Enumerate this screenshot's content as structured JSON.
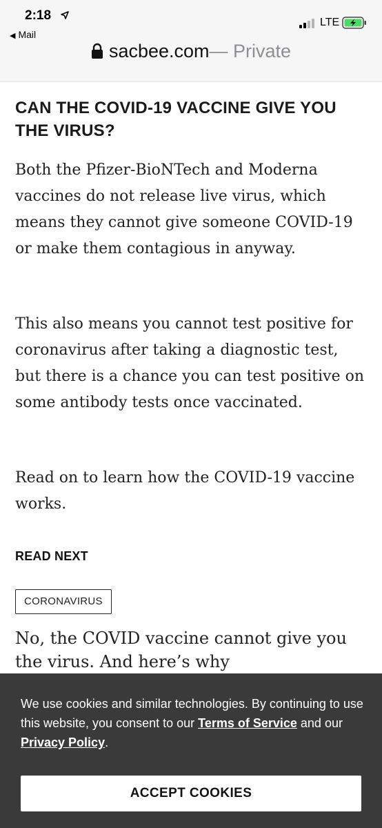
{
  "status_bar": {
    "time": "2:18",
    "back_app": "Mail",
    "network": "LTE"
  },
  "url_bar": {
    "domain": "sacbee.com",
    "mode": "— Private"
  },
  "article": {
    "headline": "CAN THE COVID-19 VACCINE GIVE YOU THE VIRUS?",
    "paragraphs": [
      "Both the Pfizer-BioNTech and Moderna vaccines do not release live virus, which means they cannot give someone COVID-19 or make them contagious in anyway.",
      "This also means you cannot test positive for coronavirus after taking a diagnostic test, but there is a chance you can test positive on some antibody tests once vaccinated.",
      "Read on to learn how the COVID-19 vaccine works."
    ],
    "read_next_label": "READ NEXT",
    "tag": "CORONAVIRUS",
    "related_title": "No, the COVID vaccine cannot give you the virus. And here’s why"
  },
  "cookie_banner": {
    "text_before": "We use cookies and similar technologies. By continuing to use this website, you consent to our ",
    "terms_link": "Terms of Service",
    "text_middle": " and our ",
    "privacy_link": "Privacy Policy",
    "text_after": ".",
    "accept_label": "ACCEPT COOKIES"
  },
  "icons": {
    "location": "location-arrow-icon",
    "lock": "lock-icon",
    "signal": "cellular-signal-icon",
    "battery": "battery-charging-icon",
    "back": "back-triangle-icon"
  },
  "colors": {
    "cookie_background": "#3a3a3a",
    "battery_fill": "#4cd964",
    "private_text": "#8e8e93"
  }
}
